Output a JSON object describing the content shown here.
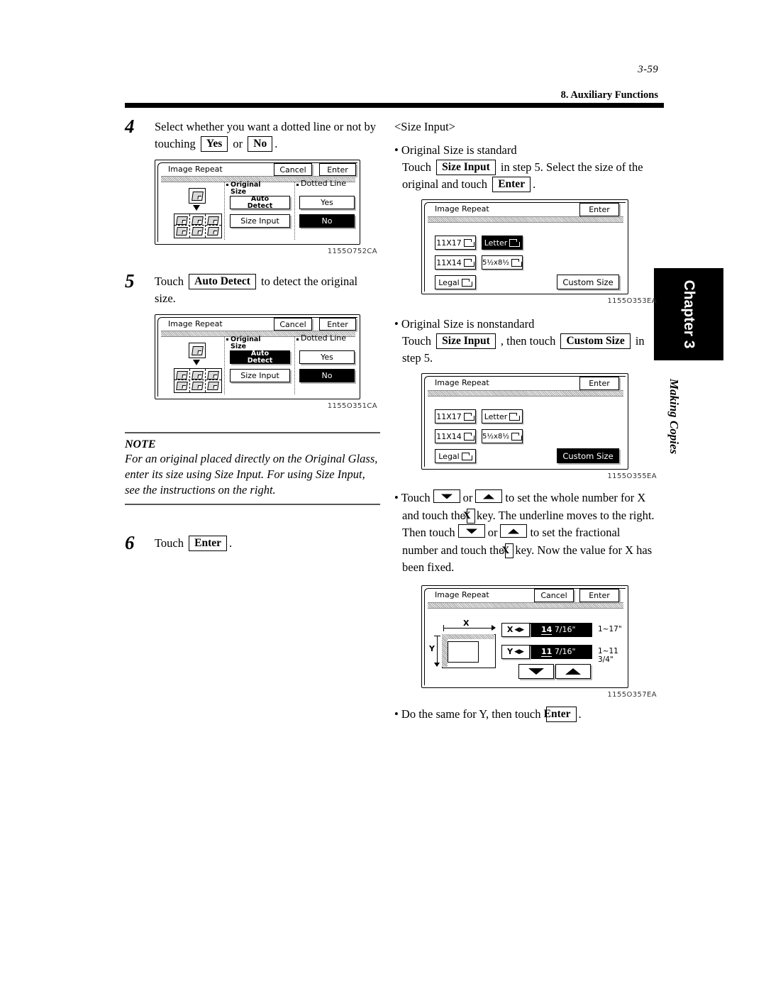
{
  "header": {
    "folio": "3-59",
    "running_head": "8. Auxiliary Functions"
  },
  "chapter_tab": {
    "label": "Chapter 3",
    "subtitle": "Making Copies"
  },
  "left_column": {
    "step4": {
      "number": "4",
      "text_a": "Select whether you want a dotted line or not by touching",
      "key_yes": "Yes",
      "or": "or",
      "key_no": "No",
      "text_b": "."
    },
    "step5": {
      "number": "5",
      "text_a": "Touch",
      "key_auto_detect": "Auto Detect",
      "text_b": "to detect the original size."
    },
    "note": {
      "heading": "NOTE",
      "body": "For an original placed directly on the Original Glass, enter its size using Size Input.  For using Size Input, see the instructions on the right."
    },
    "step6": {
      "number": "6",
      "text_a": "Touch",
      "key_enter": "Enter",
      "text_b": "."
    }
  },
  "right_column": {
    "section_title": "<Size Input>",
    "bullet_standard": {
      "heading": "Original Size is standard",
      "text_a": "Touch",
      "key_size_input": "Size Input",
      "text_b": "in step 5. Select the size of the original and touch",
      "key_enter": "Enter",
      "text_c": "."
    },
    "bullet_nonstandard": {
      "heading": "Original Size is nonstandard",
      "text_a": "Touch",
      "key_size_input": "Size Input",
      "text_b": ", then touch",
      "key_custom_size": "Custom Size",
      "text_c": "in step 5."
    },
    "bullet_arrows": {
      "t1": "Touch",
      "t2": "or",
      "t3": "to set the whole number for X and touch the",
      "key_x1": "X",
      "t4": "key. The underline moves to the right. Then touch",
      "t5": "or",
      "t6": "to set the fractional number and touch the",
      "key_x2": "X",
      "t7": "key. Now the value for X has been fixed."
    },
    "bullet_final": {
      "text_a": "Do the same for Y, then touch",
      "key_enter": "Enter",
      "text_b": "."
    }
  },
  "panels": {
    "image_repeat_no": {
      "title": "Image Repeat",
      "cancel": "Cancel",
      "enter": "Enter",
      "label_original_size": "Original\nSize",
      "label_dotted_line": "Dotted Line",
      "btn_auto_detect": "Auto\nDetect",
      "btn_size_input": "Size Input",
      "btn_yes": "Yes",
      "btn_no": "No",
      "selected": "No",
      "caption": "1155O752CA"
    },
    "image_repeat_auto": {
      "title": "Image Repeat",
      "cancel": "Cancel",
      "enter": "Enter",
      "label_original_size": "Original\nSize",
      "label_dotted_line": "Dotted Line",
      "btn_auto_detect": "Auto\nDetect",
      "btn_size_input": "Size Input",
      "btn_yes": "Yes",
      "btn_no": "No",
      "selected": "Auto Detect, No",
      "caption": "1155O351CA"
    },
    "size_select_letter": {
      "title": "Image Repeat",
      "enter": "Enter",
      "sizes": [
        "11X17",
        "11X14",
        "Legal",
        "Letter",
        "5½x8½"
      ],
      "btn_custom_size": "Custom Size",
      "selected": "Letter",
      "caption": "1155O353EA"
    },
    "size_select_custom": {
      "title": "Image Repeat",
      "enter": "Enter",
      "sizes": [
        "11X17",
        "11X14",
        "Legal",
        "Letter",
        "5½x8½"
      ],
      "btn_custom_size": "Custom Size",
      "selected": "Custom Size",
      "caption": "1155O355EA"
    },
    "custom_entry": {
      "title": "Image Repeat",
      "cancel": "Cancel",
      "enter": "Enter",
      "x_key": "X",
      "x_value_whole": "14",
      "x_value_frac": "7/16\"",
      "x_range": "1~17\"",
      "y_key": "Y",
      "y_value_whole": "11",
      "y_value_frac": "7/16\"",
      "y_range": "1~11 3/4\"",
      "diagram_x_label": "X",
      "diagram_y_label": "Y",
      "caption": "1155O357EA"
    }
  }
}
